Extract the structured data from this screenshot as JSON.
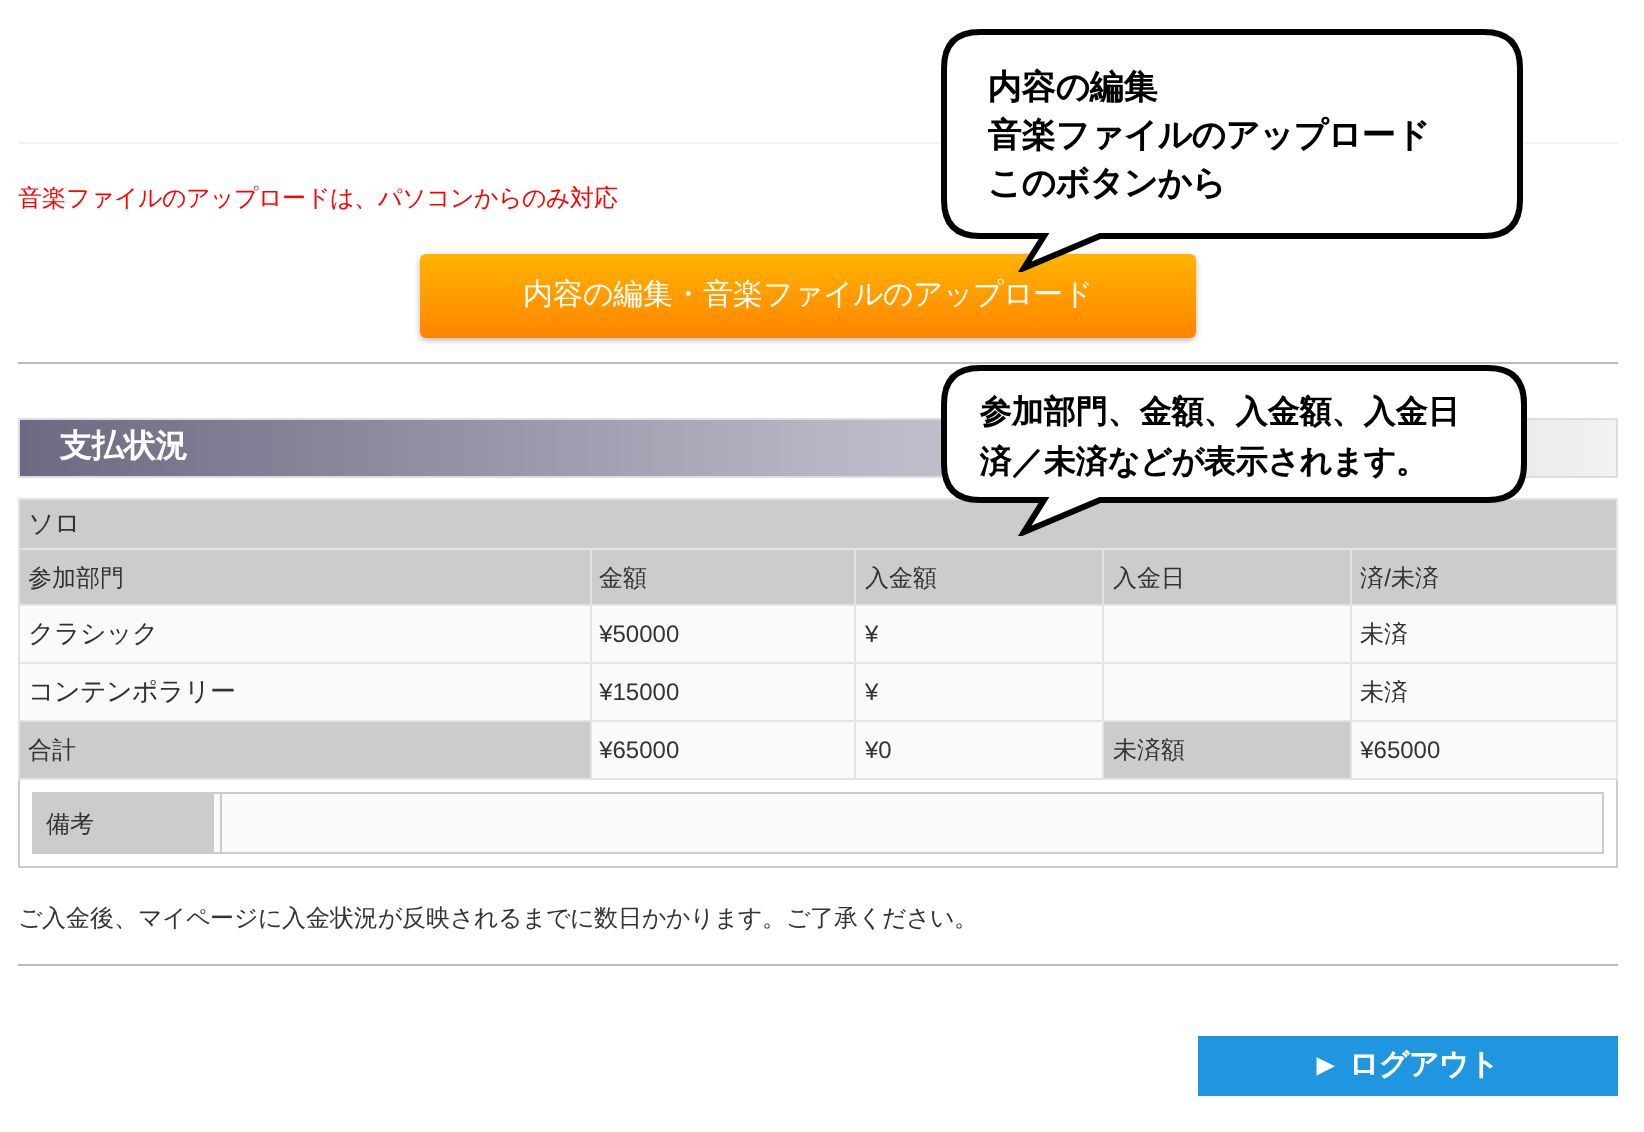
{
  "notice": "音楽ファイルのアップロードは、パソコンからのみ対応",
  "edit_button": {
    "label": "内容の編集・音楽ファイルのアップロード"
  },
  "section_title": "支払状況",
  "table": {
    "group": "ソロ",
    "columns": [
      "参加部門",
      "金額",
      "入金額",
      "入金日",
      "済/未済"
    ],
    "rows": [
      [
        "クラシック",
        "¥50000",
        "¥",
        "",
        "未済"
      ],
      [
        "コンテンポラリー",
        "¥15000",
        "¥",
        "",
        "未済"
      ]
    ],
    "total": {
      "label": "合計",
      "amount": "¥65000",
      "paid": "¥0",
      "unpaid_label": "未済額",
      "unpaid": "¥65000"
    },
    "remarks_label": "備考"
  },
  "footnote": "ご入金後、マイページに入金状況が反映されるまでに数日かかります。ご了承ください。",
  "logout_button": {
    "icon": "▶",
    "label": "ログアウト"
  },
  "callouts": [
    {
      "lines": [
        "内容の編集",
        "音楽ファイルのアップロード",
        "このボタンから"
      ]
    },
    {
      "lines": [
        "参加部門、金額、入金額、入金日",
        "済／未済などが表示されます。"
      ]
    }
  ]
}
